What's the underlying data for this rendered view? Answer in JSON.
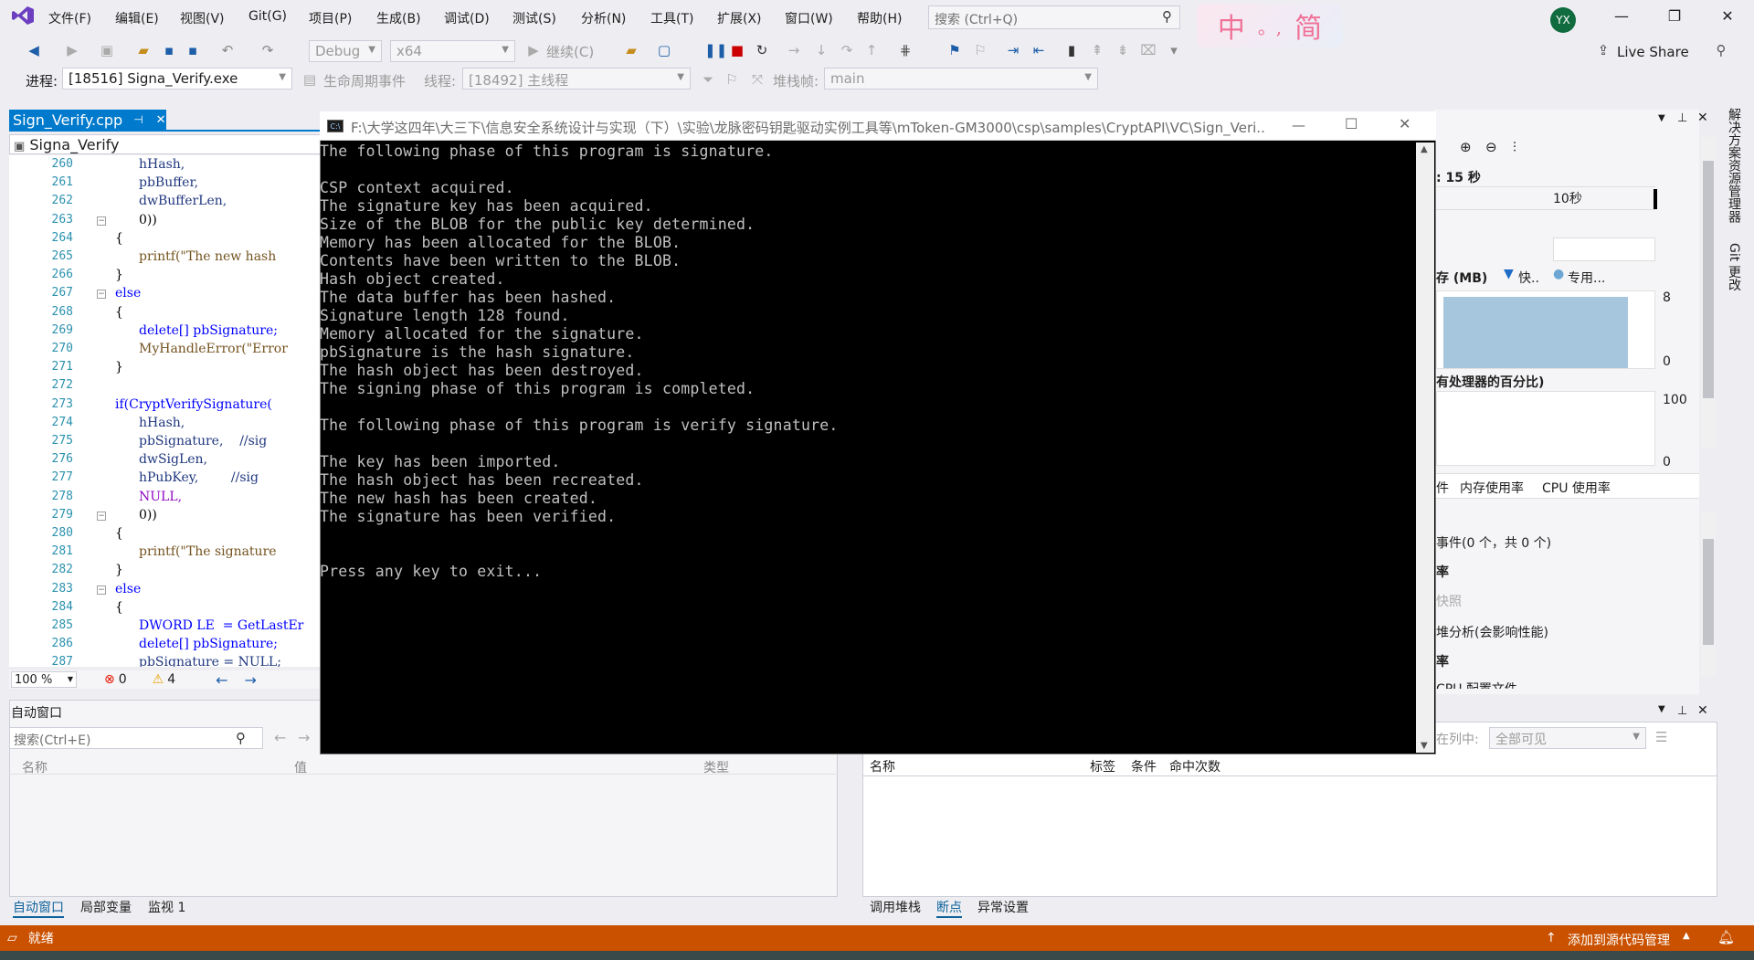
{
  "menubar": {
    "items": [
      "文件(F)",
      "编辑(E)",
      "视图(V)",
      "Git(G)",
      "项目(P)",
      "生成(B)",
      "调试(D)",
      "测试(S)",
      "分析(N)",
      "工具(T)",
      "扩展(X)",
      "窗口(W)",
      "帮助(H)"
    ],
    "search_placeholder": "搜索 (Ctrl+Q)",
    "ime_chars": [
      "中",
      "。,",
      "简"
    ],
    "avatar_initials": "YX",
    "live_share": "Live Share"
  },
  "toolbar": {
    "config": "Debug",
    "platform": "x64",
    "continue": "继续(C)"
  },
  "debugbar": {
    "process_label": "进程:",
    "process_value": "[18516] Signa_Verify.exe",
    "lifecycle": "生命周期事件",
    "thread_label": "线程:",
    "thread_value": "[18492] 主线程",
    "stack_label": "堆栈帧:",
    "stack_value": "main"
  },
  "editor": {
    "tab_name": "Sign_Verify.cpp",
    "nav_scope": "Signa_Verify",
    "zoom": "100 %",
    "errors": "0",
    "warnings": "4",
    "lines": [
      {
        "n": "260",
        "t": "hHash,",
        "indent": 2
      },
      {
        "n": "261",
        "t": "pbBuffer,",
        "indent": 2
      },
      {
        "n": "262",
        "t": "dwBufferLen,",
        "indent": 2
      },
      {
        "n": "263",
        "t": "0))",
        "indent": 2
      },
      {
        "n": "264",
        "t": "{",
        "indent": 1
      },
      {
        "n": "265",
        "t": "printf(\"The new hash",
        "indent": 2
      },
      {
        "n": "266",
        "t": "}",
        "indent": 1
      },
      {
        "n": "267",
        "t": "else",
        "indent": 1
      },
      {
        "n": "268",
        "t": "{",
        "indent": 1
      },
      {
        "n": "269",
        "t": "delete[] pbSignature;",
        "indent": 2
      },
      {
        "n": "270",
        "t": "MyHandleError(\"Error",
        "indent": 2
      },
      {
        "n": "271",
        "t": "}",
        "indent": 1
      },
      {
        "n": "272",
        "t": "",
        "indent": 0
      },
      {
        "n": "273",
        "t": "if(CryptVerifySignature(",
        "indent": 1
      },
      {
        "n": "274",
        "t": "hHash,",
        "indent": 2
      },
      {
        "n": "275",
        "t": "pbSignature,    //sig",
        "indent": 2
      },
      {
        "n": "276",
        "t": "dwSigLen,",
        "indent": 2
      },
      {
        "n": "277",
        "t": "hPubKey,        //sig",
        "indent": 2
      },
      {
        "n": "278",
        "t": "NULL,",
        "indent": 2
      },
      {
        "n": "279",
        "t": "0))",
        "indent": 2
      },
      {
        "n": "280",
        "t": "{",
        "indent": 1
      },
      {
        "n": "281",
        "t": "printf(\"The signature",
        "indent": 2
      },
      {
        "n": "282",
        "t": "}",
        "indent": 1
      },
      {
        "n": "283",
        "t": "else",
        "indent": 1
      },
      {
        "n": "284",
        "t": "{",
        "indent": 1
      },
      {
        "n": "285",
        "t": "DWORD LE  = GetLastEr",
        "indent": 2
      },
      {
        "n": "286",
        "t": "delete[] pbSignature;",
        "indent": 2
      },
      {
        "n": "287",
        "t": "pbSignature = NULL;",
        "indent": 2
      }
    ]
  },
  "console": {
    "title": "F:\\大学这四年\\大三下\\信息安全系统设计与实现（下）\\实验\\龙脉密码钥匙驱动实例工具等\\mToken-GM3000\\csp\\samples\\CryptAPI\\VC\\Sign_Veri...",
    "lines": [
      "The following phase of this program is signature.",
      "",
      "CSP context acquired.",
      "The signature key has been acquired.",
      "Size of the BLOB for the public key determined.",
      "Memory has been allocated for the BLOB.",
      "Contents have been written to the BLOB.",
      "Hash object created.",
      "The data buffer has been hashed.",
      "Signature length 128 found.",
      "Memory allocated for the signature.",
      "pbSignature is the hash signature.",
      "The hash object has been destroyed.",
      "The signing phase of this program is completed.",
      "",
      "The following phase of this program is verify signature.",
      "",
      "The key has been imported.",
      "The hash object has been recreated.",
      "The new hash has been created.",
      "The signature has been verified.",
      "",
      "",
      "Press any key to exit..."
    ]
  },
  "diag": {
    "duration": ": 15 秒",
    "tick": "10秒",
    "mem_label": "存 (MB)",
    "legend_fast": "快..",
    "legend_private": "专用...",
    "mem_max": "8",
    "mem_min": "0",
    "cpu_label": "有处理器的百分比)",
    "cpu_max": "100",
    "cpu_min": "0",
    "tabs": [
      "件",
      "内存使用率",
      "CPU 使用率"
    ],
    "events": "事件(0 个，共 0 个)",
    "row_rate1": "率",
    "snapshot": "快照",
    "heap": "堆分析(会影响性能)",
    "row_rate2": "率",
    "cpu_profile": "CPU 配置文件"
  },
  "side_tabs": [
    "解决方案资源管理器",
    "Git 更改"
  ],
  "auto_window": {
    "title": "自动窗口",
    "search_placeholder": "搜索(Ctrl+E)",
    "columns": [
      "名称",
      "值",
      "类型"
    ],
    "tabs": [
      "自动窗口",
      "局部变量",
      "监视 1"
    ]
  },
  "breakpoints": {
    "search_in_label": "在列中:",
    "search_in_value": "全部可见",
    "columns": [
      "名称",
      "标签",
      "条件",
      "命中次数"
    ],
    "tabs": [
      "调用堆栈",
      "断点",
      "异常设置"
    ]
  },
  "status": {
    "ready": "就绪",
    "source_control": "添加到源代码管理"
  }
}
